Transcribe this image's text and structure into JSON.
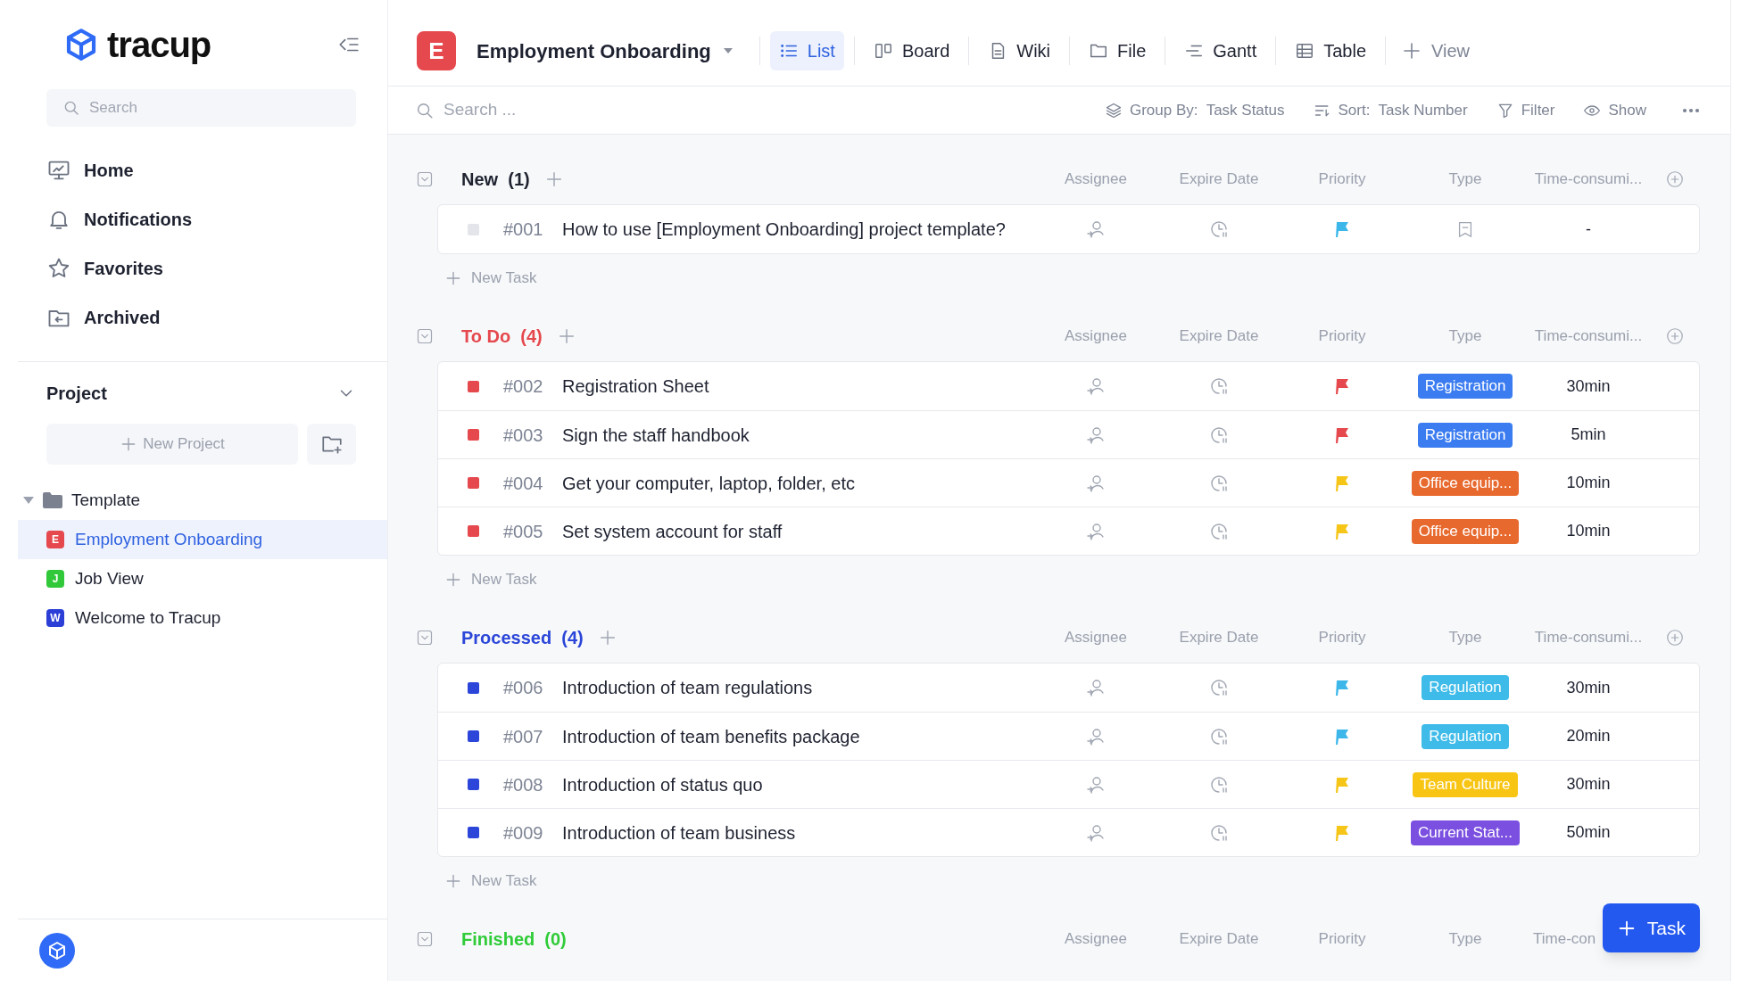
{
  "sidebar": {
    "logo_text": "tracup",
    "search": {
      "placeholder": "Search"
    },
    "nav": [
      {
        "label": "Home"
      },
      {
        "label": "Notifications"
      },
      {
        "label": "Favorites"
      },
      {
        "label": "Archived"
      }
    ],
    "project": {
      "title": "Project",
      "new_project": "New Project",
      "tree": [
        {
          "label": "Template",
          "expanded": true,
          "children": [
            {
              "badge": "E",
              "label": "Employment Onboarding",
              "color": "#e5484d",
              "selected": true
            },
            {
              "badge": "J",
              "label": "Job View",
              "color": "#31c93a",
              "selected": false
            },
            {
              "badge": "W",
              "label": "Welcome to Tracup",
              "color": "#2b3fd6",
              "selected": false
            }
          ]
        }
      ]
    }
  },
  "header": {
    "badge": "E",
    "title": "Employment Onboarding",
    "views": [
      {
        "label": "List",
        "selected": true
      },
      {
        "label": "Board",
        "selected": false
      },
      {
        "label": "Wiki",
        "selected": false
      },
      {
        "label": "File",
        "selected": false
      },
      {
        "label": "Gantt",
        "selected": false
      },
      {
        "label": "Table",
        "selected": false
      }
    ],
    "add_view": "View"
  },
  "toolbar": {
    "search": {
      "placeholder": "Search ..."
    },
    "group_by": {
      "label": "Group By:",
      "value": "Task Status"
    },
    "sort": {
      "label": "Sort:",
      "value": "Task Number"
    },
    "filter": "Filter",
    "show": "Show"
  },
  "groups": [
    {
      "name": "New",
      "count": "(1)",
      "color": "#1f2330",
      "status_dot": {
        "color": "#e3e5ea"
      },
      "add_column": true,
      "columns": [
        "Assignee",
        "Expire Date",
        "Priority",
        "Type",
        "Time-consumi..."
      ],
      "new_task": "New Task",
      "tasks": [
        {
          "number": "#001",
          "title": "How to use [Employment Onboarding] project template?",
          "priority": {
            "color": "#3db7ea"
          },
          "time": "-"
        }
      ]
    },
    {
      "name": "To Do",
      "count": "(4)",
      "color": "#e5484d",
      "status_dot": {
        "color": "#e5484d"
      },
      "add_column": true,
      "columns": [
        "Assignee",
        "Expire Date",
        "Priority",
        "Type",
        "Time-consumi..."
      ],
      "new_task": "New Task",
      "tasks": [
        {
          "number": "#002",
          "title": "Registration Sheet",
          "priority": {
            "color": "#e5484d"
          },
          "type": {
            "label": "Registration",
            "color": "#3b7cf0"
          },
          "time": "30min"
        },
        {
          "number": "#003",
          "title": "Sign the staff handbook",
          "priority": {
            "color": "#e5484d"
          },
          "type": {
            "label": "Registration",
            "color": "#3b7cf0"
          },
          "time": "5min"
        },
        {
          "number": "#004",
          "title": "Get your computer, laptop, folder, etc",
          "priority": {
            "color": "#f5c518"
          },
          "type": {
            "label": "Office equip...",
            "color": "#e8692e"
          },
          "time": "10min"
        },
        {
          "number": "#005",
          "title": "Set system account for staff",
          "priority": {
            "color": "#f5c518"
          },
          "type": {
            "label": "Office equip...",
            "color": "#e8692e"
          },
          "time": "10min"
        }
      ]
    },
    {
      "name": "Processed",
      "count": "(4)",
      "color": "#2b46d8",
      "status_dot": {
        "color": "#2b46d8"
      },
      "add_column": true,
      "columns": [
        "Assignee",
        "Expire Date",
        "Priority",
        "Type",
        "Time-consumi..."
      ],
      "new_task": "New Task",
      "tasks": [
        {
          "number": "#006",
          "title": "Introduction of team regulations",
          "priority": {
            "color": "#3db7ea"
          },
          "type": {
            "label": "Regulation",
            "color": "#3ebbe9"
          },
          "time": "30min"
        },
        {
          "number": "#007",
          "title": "Introduction of team benefits package",
          "priority": {
            "color": "#3db7ea"
          },
          "type": {
            "label": "Regulation",
            "color": "#3ebbe9"
          },
          "time": "20min"
        },
        {
          "number": "#008",
          "title": "Introduction of status quo",
          "priority": {
            "color": "#f5c518"
          },
          "type": {
            "label": "Team Culture",
            "color": "#f8c514"
          },
          "time": "30min"
        },
        {
          "number": "#009",
          "title": "Introduction of team business",
          "priority": {
            "color": "#f5c518"
          },
          "type": {
            "label": "Current Stat...",
            "color": "#7b4fe0"
          },
          "time": "50min"
        }
      ]
    },
    {
      "name": "Finished",
      "count": "(0)",
      "color": "#2fcc38",
      "add_column": false,
      "columns": [
        "Assignee",
        "Expire Date",
        "Priority",
        "Type",
        "Time-con"
      ]
    }
  ],
  "task_button": "Task"
}
